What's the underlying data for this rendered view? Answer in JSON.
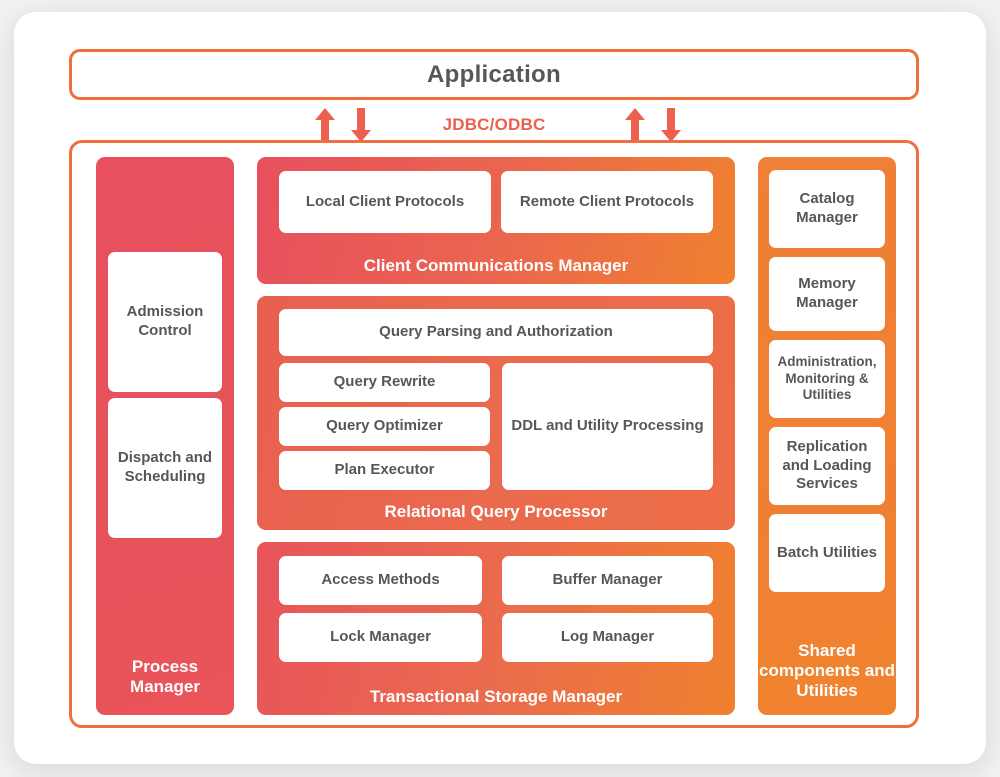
{
  "diagram": {
    "application": {
      "label": "Application"
    },
    "connector": {
      "protocol_label": "JDBC/ODBC",
      "arrow_up_icon": "arrow-up-icon",
      "arrow_down_icon": "arrow-down-icon"
    },
    "process_manager": {
      "title": "Process Manager",
      "color": "#E8505E",
      "components": [
        {
          "label": "Admission Control"
        },
        {
          "label": "Dispatch and Scheduling"
        }
      ]
    },
    "client_communications": {
      "title": "Client Communications Manager",
      "color_start": "#E8505E",
      "color_end": "#F0812F",
      "components": [
        {
          "label": "Local Client Protocols"
        },
        {
          "label": "Remote Client Protocols"
        }
      ]
    },
    "relational_query_processor": {
      "title": "Relational Query Processor",
      "color": "#EA6A4E",
      "components": [
        {
          "label": "Query Parsing and Authorization"
        },
        {
          "label": "Query Rewrite"
        },
        {
          "label": "Query Optimizer"
        },
        {
          "label": "Plan Executor"
        },
        {
          "label": "DDL and Utility Processing"
        }
      ]
    },
    "transactional_storage_manager": {
      "title": "Transactional Storage Manager",
      "color_start": "#E8545B",
      "color_end": "#F0812F",
      "components": [
        {
          "label": "Access Methods"
        },
        {
          "label": "Buffer Manager"
        },
        {
          "label": "Lock Manager"
        },
        {
          "label": "Log Manager"
        }
      ]
    },
    "shared_components": {
      "title": "Shared components and Utilities",
      "color": "#EE8037",
      "components": [
        {
          "label": "Catalog Manager"
        },
        {
          "label": "Memory Manager"
        },
        {
          "label": "Administration, Monitoring & Utilities"
        },
        {
          "label": "Replication and Loading Services"
        },
        {
          "label": "Batch Utilities"
        }
      ]
    },
    "frame": {
      "border_color": "#EF6F3F"
    }
  }
}
